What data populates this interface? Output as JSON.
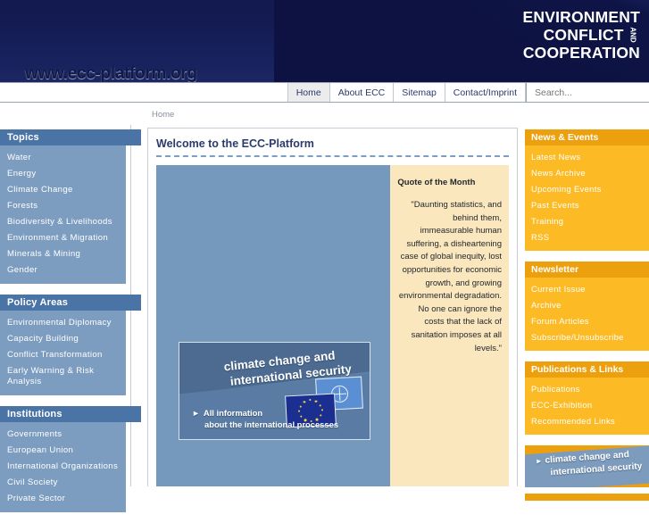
{
  "header": {
    "site_url": "www.ecc-platform.org",
    "brand_line1": "ENVIRONMENT",
    "brand_line2": "CONFLICT",
    "brand_and": "AND",
    "brand_line3": "COOPERATION"
  },
  "topnav": {
    "items": [
      {
        "label": "Home",
        "active": true
      },
      {
        "label": "About ECC",
        "active": false
      },
      {
        "label": "Sitemap",
        "active": false
      },
      {
        "label": "Contact/Imprint",
        "active": false
      }
    ],
    "search_placeholder": "Search...",
    "search_value": ""
  },
  "breadcrumb": {
    "text": "Home"
  },
  "sidebar_left": {
    "blocks": [
      {
        "title": "Topics",
        "items": [
          "Water",
          "Energy",
          "Climate Change",
          "Forests",
          "Biodiversity & Livelihoods",
          "Environment & Migration",
          "Minerals & Mining",
          "Gender"
        ]
      },
      {
        "title": "Policy Areas",
        "items": [
          "Environmental Diplomacy",
          "Capacity Building",
          "Conflict Transformation",
          "Early Warning & Risk Analysis"
        ]
      },
      {
        "title": "Institutions",
        "items": [
          "Governments",
          "European Union",
          "International Organizations",
          "Civil Society",
          "Private Sector"
        ]
      }
    ]
  },
  "main": {
    "title": "Welcome to the ECC-Platform",
    "quote_title": "Quote of the Month",
    "quote_text": "\"Daunting statistics, and behind them, immeasurable human suffering, a disheartening case of global inequity, lost opportunities for economic growth, and growing environmental degradation. No one can ignore the costs that the lack of sanitation imposes at all levels.\"",
    "promo": {
      "title_line1": "climate change and",
      "title_line2": "international security",
      "cta_line1": "All information",
      "cta_line2": "about the international processes",
      "arrow": "►",
      "flag_eu_name": "european-union-flag",
      "flag_un_name": "united-nations-flag"
    }
  },
  "sidebar_right": {
    "blocks": [
      {
        "title": "News & Events",
        "items": [
          "Latest News",
          "News Archive",
          "Upcoming Events",
          "Past Events",
          "Training",
          "RSS"
        ]
      },
      {
        "title": "Newsletter",
        "items": [
          "Current Issue",
          "Archive",
          "Forum Articles",
          "Subscribe/Unsubscribe"
        ]
      },
      {
        "title": "Publications & Links",
        "items": [
          "Publications",
          "ECC-Exhibition",
          "Recommended Links"
        ]
      }
    ],
    "promo": {
      "arrow": "►",
      "line1": "climate change and",
      "line2": "international security"
    }
  },
  "colors": {
    "brand_navy": "#11184a",
    "sidebar_head_blue": "#4a74a5",
    "sidebar_body_blue": "#7c9dc0",
    "right_head_orange": "#eda00e",
    "right_body_orange": "#fcbb25",
    "quote_cream": "#fbe7bd",
    "content_blue": "#7499bd",
    "title_navy": "#2b3b6b"
  }
}
